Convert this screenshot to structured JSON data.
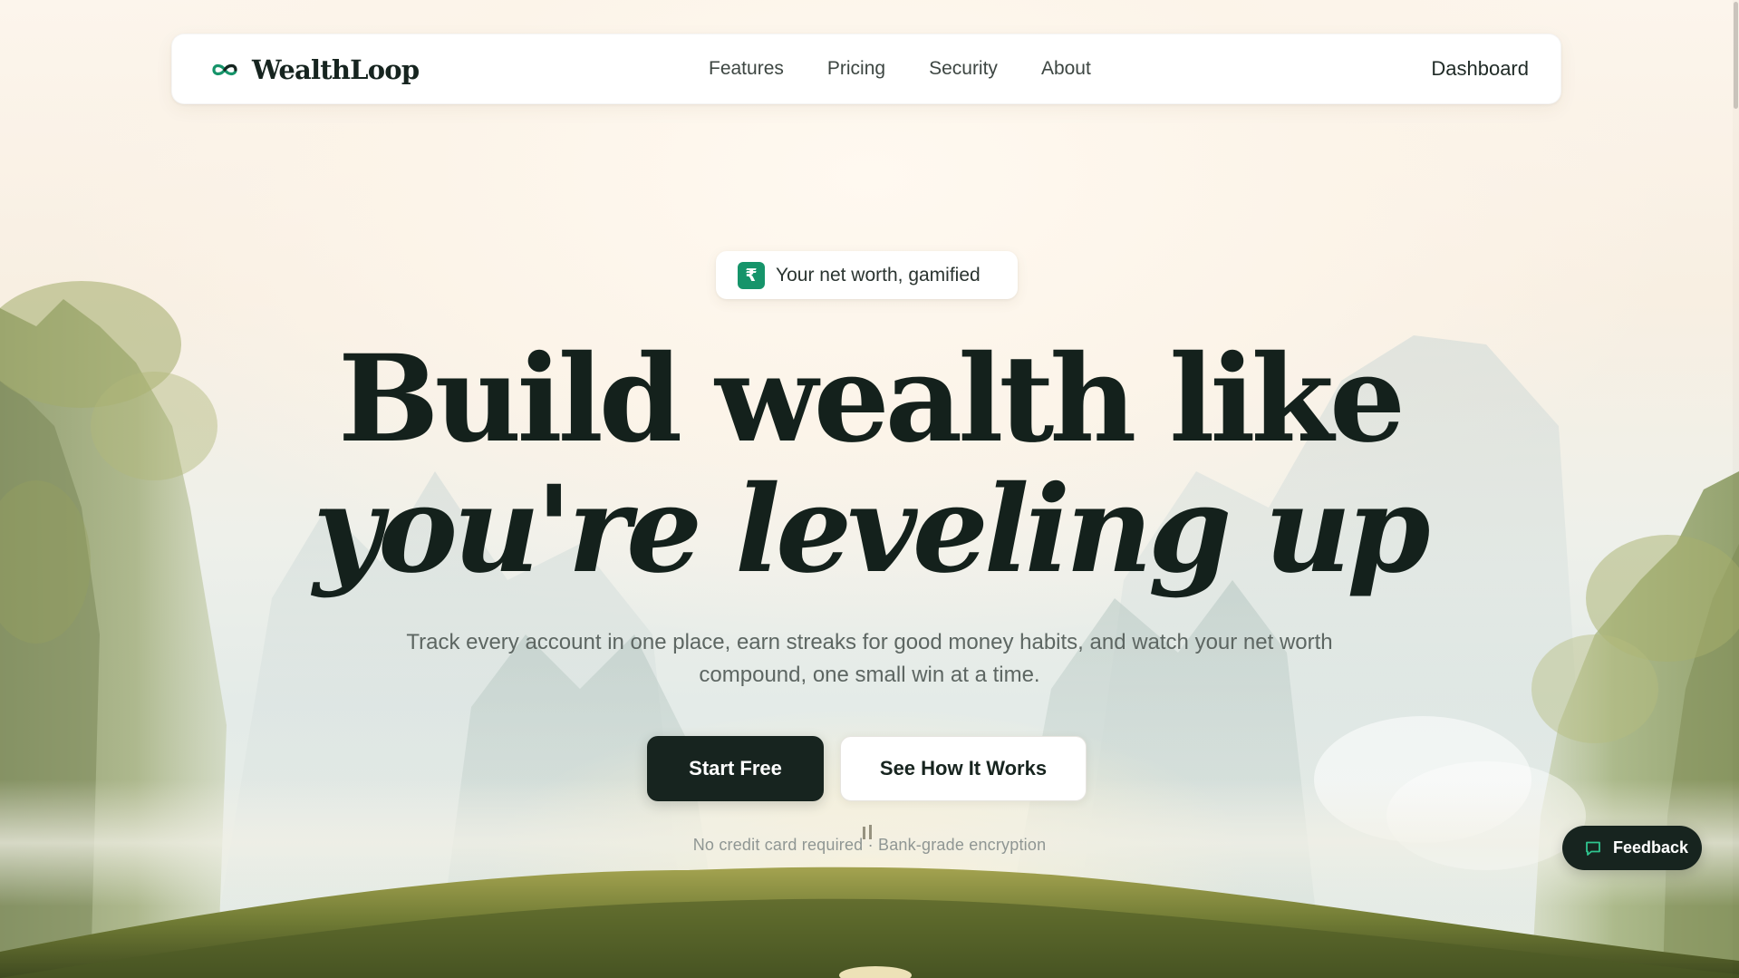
{
  "app": {
    "brand_name": "WealthLoop",
    "logo_icon": "infinity-loop-icon",
    "accent_color": "#16946a",
    "dark_color": "#17241f"
  },
  "nav": {
    "links": [
      {
        "label": "Features"
      },
      {
        "label": "Pricing"
      },
      {
        "label": "Security"
      },
      {
        "label": "About"
      }
    ],
    "dashboard_label": "Dashboard"
  },
  "hero": {
    "badge_icon": "rupee-icon",
    "badge_icon_glyph": "₹",
    "badge_text": "Your net worth, gamified",
    "headline_line1": "Build wealth like",
    "headline_line2": "you're leveling up",
    "subheadline": "Track every account in one place, earn streaks for good money habits, and watch your net worth compound, one small win at a time.",
    "primary_cta": "Start Free",
    "secondary_cta": "See How It Works",
    "fineprint": "No credit card required · Bank-grade encryption"
  },
  "feedback": {
    "label": "Feedback",
    "icon": "chat-bubble-icon"
  }
}
